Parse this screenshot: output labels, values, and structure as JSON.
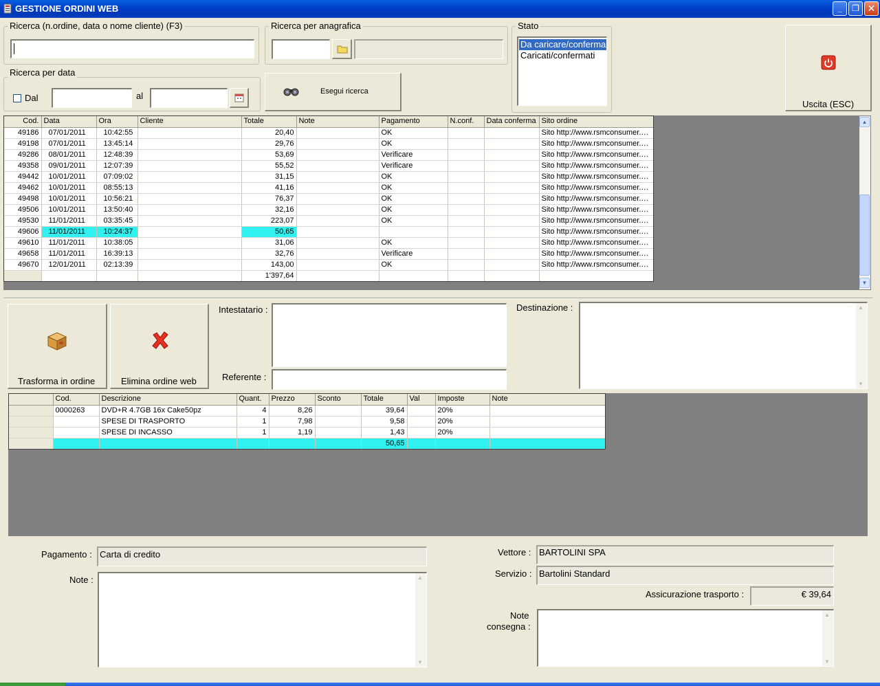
{
  "window": {
    "title": "GESTIONE ORDINI WEB"
  },
  "search": {
    "group_label": "Ricerca (n.ordine, data o nome cliente) (F3)",
    "value": ""
  },
  "anagrafica": {
    "group_label": "Ricerca per anagrafica"
  },
  "date_search": {
    "group_label": "Ricerca per data",
    "dal_label": "Dal",
    "al_label": "al",
    "checked": false
  },
  "search_button": {
    "label": "Esegui ricerca"
  },
  "stato": {
    "group_label": "Stato",
    "items": [
      "Da caricare/confermare",
      "Caricati/confermati"
    ],
    "selected_index": 0
  },
  "exit_button": {
    "label": "Uscita (ESC)"
  },
  "orders": {
    "columns": [
      "Cod.",
      "Data",
      "Ora",
      "Cliente",
      "Totale",
      "Note",
      "Pagamento",
      "N.conf.",
      "Data conferma",
      "Sito ordine"
    ],
    "rows": [
      [
        "49186",
        "07/01/2011",
        "10:42:55",
        "",
        "20,40",
        "",
        "OK",
        "",
        "",
        "Sito http://www.rsmconsumer.c..."
      ],
      [
        "49198",
        "07/01/2011",
        "13:45:14",
        "",
        "29,76",
        "",
        "OK",
        "",
        "",
        "Sito http://www.rsmconsumer.c..."
      ],
      [
        "49286",
        "08/01/2011",
        "12:48:39",
        "",
        "53,69",
        "",
        "Verificare",
        "",
        "",
        "Sito http://www.rsmconsumer.c..."
      ],
      [
        "49358",
        "09/01/2011",
        "12:07:39",
        "",
        "55,52",
        "",
        "Verificare",
        "",
        "",
        "Sito http://www.rsmconsumer.c..."
      ],
      [
        "49442",
        "10/01/2011",
        "07:09:02",
        "",
        "31,15",
        "",
        "OK",
        "",
        "",
        "Sito http://www.rsmconsumer.c..."
      ],
      [
        "49462",
        "10/01/2011",
        "08:55:13",
        "",
        "41,16",
        "",
        "OK",
        "",
        "",
        "Sito http://www.rsmconsumer.c..."
      ],
      [
        "49498",
        "10/01/2011",
        "10:56:21",
        "",
        "76,37",
        "",
        "OK",
        "",
        "",
        "Sito http://www.rsmconsumer.c..."
      ],
      [
        "49506",
        "10/01/2011",
        "13:50:40",
        "",
        "32,16",
        "",
        "OK",
        "",
        "",
        "Sito http://www.rsmconsumer.c..."
      ],
      [
        "49530",
        "11/01/2011",
        "03:35:45",
        "",
        "223,07",
        "",
        "OK",
        "",
        "",
        "Sito http://www.rsmconsumer.c..."
      ],
      [
        "49606",
        "11/01/2011",
        "10:24:37",
        "",
        "50,65",
        "",
        "",
        "",
        "",
        "Sito http://www.rsmconsumer.c..."
      ],
      [
        "49610",
        "11/01/2011",
        "10:38:05",
        "",
        "31,06",
        "",
        "OK",
        "",
        "",
        "Sito http://www.rsmconsumer.c..."
      ],
      [
        "49658",
        "11/01/2011",
        "16:39:13",
        "",
        "32,76",
        "",
        "Verificare",
        "",
        "",
        "Sito http://www.rsmconsumer.c..."
      ],
      [
        "49670",
        "12/01/2011",
        "02:13:39",
        "",
        "143,00",
        "",
        "OK",
        "",
        "",
        "Sito http://www.rsmconsumer.c..."
      ]
    ],
    "highlighted_row": 9,
    "total": "1'397,64"
  },
  "actions": {
    "convert_label": "Trasforma in ordine",
    "delete_label": "Elimina ordine web"
  },
  "customer": {
    "intestatario_label": "Intestatario :",
    "referente_label": "Referente :",
    "destinazione_label": "Destinazione :"
  },
  "items": {
    "columns": [
      "",
      "Cod.",
      "Descrizione",
      "Quant.",
      "Prezzo",
      "Sconto",
      "Totale",
      "Val",
      "Imposte",
      "Note"
    ],
    "rows": [
      [
        "",
        "0000263",
        "DVD+R 4.7GB 16x Cake50pz",
        "4",
        "8,26",
        "",
        "39,64",
        "",
        "20%",
        ""
      ],
      [
        "",
        "",
        "SPESE DI TRASPORTO",
        "1",
        "7,98",
        "",
        "9,58",
        "",
        "20%",
        ""
      ],
      [
        "",
        "",
        "SPESE DI INCASSO",
        "1",
        "1,19",
        "",
        "1,43",
        "",
        "20%",
        ""
      ]
    ],
    "total": "50,65"
  },
  "footer": {
    "pagamento_label": "Pagamento :",
    "pagamento_value": "Carta di credito",
    "note_label": "Note :",
    "vettore_label": "Vettore :",
    "vettore_value": "BARTOLINI SPA",
    "servizio_label": "Servizio :",
    "servizio_value": "Bartolini Standard",
    "assicurazione_label": "Assicurazione trasporto :",
    "assicurazione_value": "€ 39,64",
    "note_consegna_label_1": "Note",
    "note_consegna_label_2": "consegna :"
  },
  "colors": {
    "highlight": "#30f0f0",
    "titlebar": "#0040c8",
    "grey_area": "#808080"
  }
}
